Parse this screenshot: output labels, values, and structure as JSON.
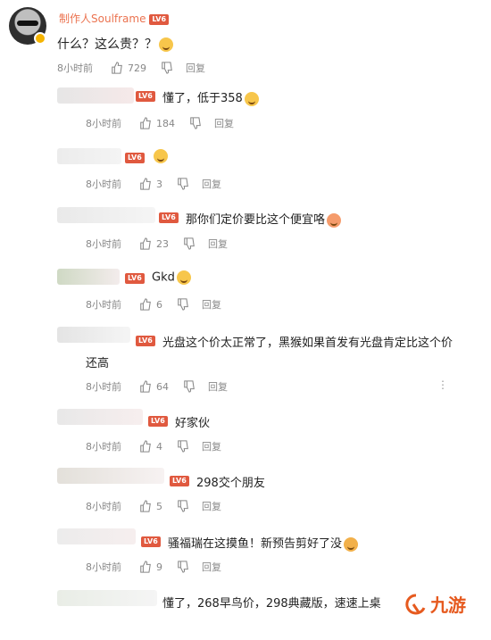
{
  "main_comment": {
    "author": "制作人Soulframe",
    "level": "LV6",
    "text": "什么？这么贵？？",
    "time": "8小时前",
    "likes": "729",
    "reply": "回复"
  },
  "replies": [
    {
      "text": "懂了，低于358",
      "time": "8小时前",
      "likes": "184",
      "reply": "回复",
      "level": "LV6"
    },
    {
      "text": "",
      "time": "8小时前",
      "likes": "3",
      "reply": "回复",
      "level": "LV6"
    },
    {
      "text": "那你们定价要比这个便宜咯",
      "time": "8小时前",
      "likes": "23",
      "reply": "回复",
      "level": "LV6"
    },
    {
      "text": "Gkd",
      "time": "8小时前",
      "likes": "6",
      "reply": "回复",
      "level": "LV6"
    },
    {
      "text": "光盘这个价太正常了，黑猴如果首发有光盘肯定比这个价",
      "text2": "还高",
      "time": "8小时前",
      "likes": "64",
      "reply": "回复",
      "level": "LV6"
    },
    {
      "text": "好家伙",
      "time": "8小时前",
      "likes": "4",
      "reply": "回复",
      "level": "LV6"
    },
    {
      "text": "298交个朋友",
      "time": "8小时前",
      "likes": "5",
      "reply": "回复",
      "level": "LV6"
    },
    {
      "text": "骚福瑞在这摸鱼！新预告剪好了没",
      "time": "8小时前",
      "likes": "9",
      "reply": "回复",
      "level": "LV6"
    },
    {
      "text": "懂了，268早鸟价，298典藏版，速速上桌",
      "time": "8小时前",
      "likes": "",
      "reply": "",
      "level": ""
    }
  ],
  "watermark": {
    "text": "九游",
    "icon": "jiuyou-logo-icon"
  },
  "colors": {
    "author": "#eb7350",
    "level_badge": "#e0593f",
    "meta": "#888888",
    "watermark": "#e65a1f"
  }
}
